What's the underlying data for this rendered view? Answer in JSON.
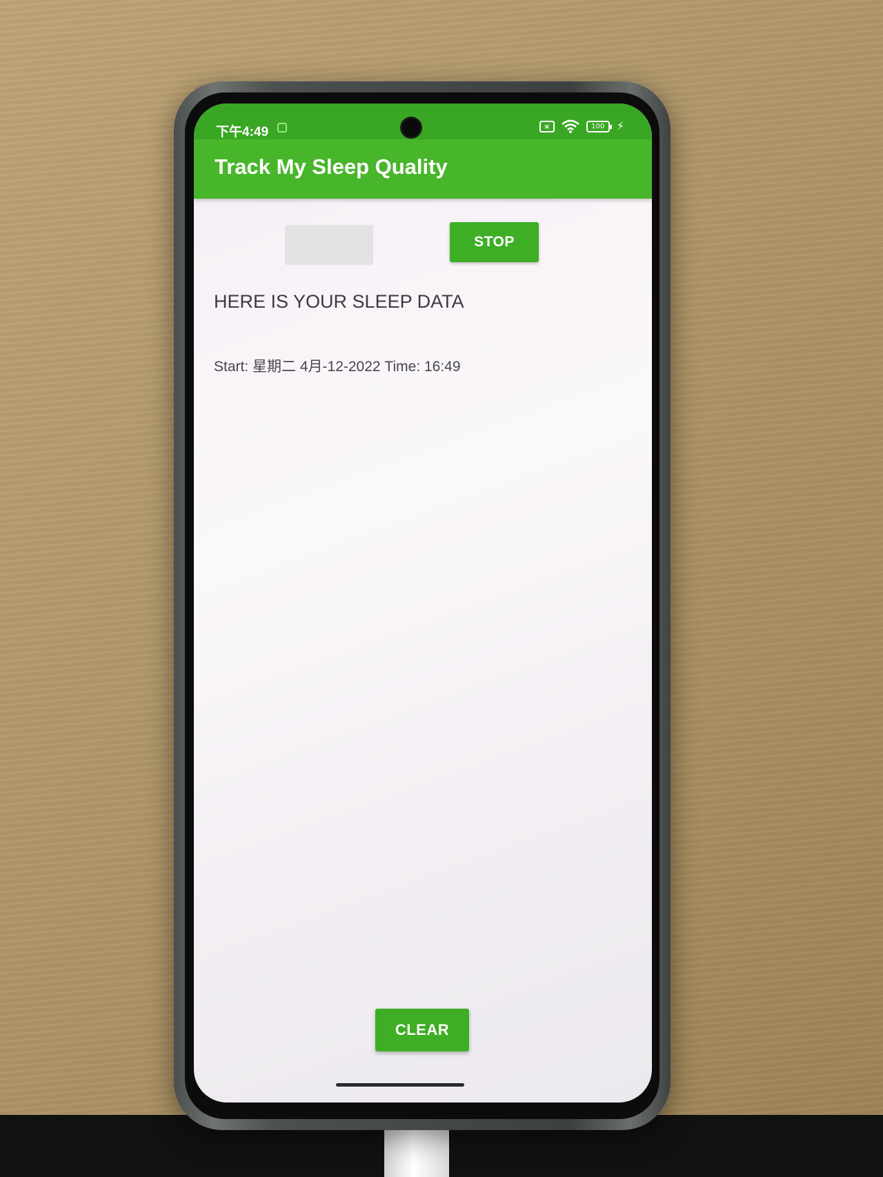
{
  "status_bar": {
    "time": "下午4:49",
    "battery": "100"
  },
  "app_bar": {
    "title": "Track My Sleep Quality"
  },
  "controls": {
    "start_label": "",
    "stop_label": "STOP"
  },
  "content": {
    "heading": "HERE IS YOUR SLEEP DATA",
    "record": "Start: 星期二 4月-12-2022 Time: 16:49"
  },
  "footer": {
    "clear_label": "CLEAR"
  },
  "colors": {
    "status_bar": "#3aa724",
    "app_bar": "#48b62a",
    "button": "#3eae24"
  }
}
